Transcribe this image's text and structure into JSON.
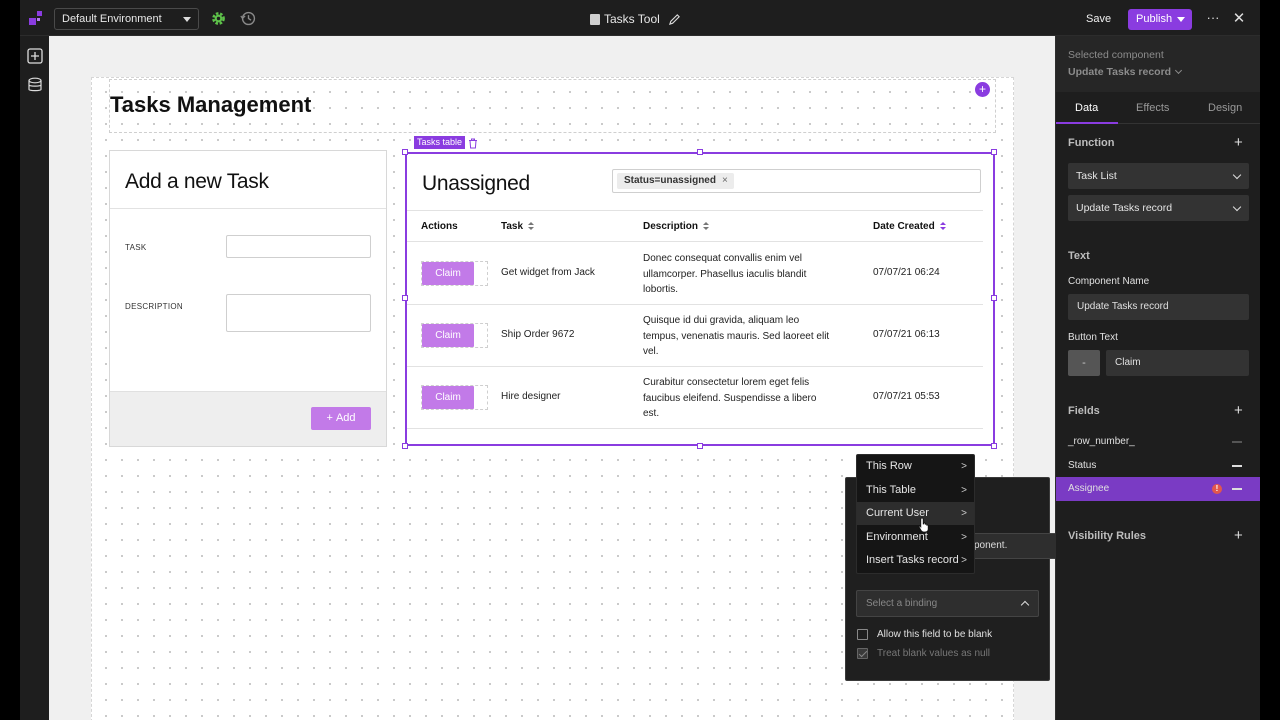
{
  "topbar": {
    "environment": "Default Environment",
    "doc_title": "Tasks Tool",
    "save_label": "Save",
    "publish_label": "Publish",
    "more_label": "···",
    "close_label": "✕"
  },
  "canvas": {
    "page_title": "Tasks Management",
    "add_card": {
      "title": "Add a new Task",
      "task_label": "TASK",
      "description_label": "DESCRIPTION",
      "task_value": "",
      "description_value": "",
      "add_button": "Add"
    },
    "table": {
      "label": "Tasks table",
      "title": "Unassigned",
      "filter_chip": "Status=unassigned",
      "columns": [
        "Actions",
        "Task",
        "Description",
        "Date Created"
      ],
      "rows": [
        {
          "action": "Claim",
          "task": "Get widget from Jack",
          "description": "Donec consequat convallis enim vel ullamcorper. Phasellus iaculis blandit lobortis.",
          "date": "07/07/21 06:24"
        },
        {
          "action": "Claim",
          "task": "Ship Order 9672",
          "description": "Quisque id dui gravida, aliquam leo tempus, venenatis mauris. Sed laoreet elit vel.",
          "date": "07/07/21 06:13"
        },
        {
          "action": "Claim",
          "task": "Hire designer",
          "description": "Curabitur consectetur lorem eget felis faucibus eleifend. Suspendisse a libero est.",
          "date": "07/07/21 05:53"
        }
      ]
    }
  },
  "context_menu": {
    "items": [
      {
        "label": "This Row",
        "arrow": ">"
      },
      {
        "label": "This Table",
        "arrow": ">"
      },
      {
        "label": "Current User",
        "arrow": ">"
      },
      {
        "label": "Environment",
        "arrow": ">"
      },
      {
        "label": "Insert Tasks record",
        "arrow": ">"
      }
    ],
    "hovered_index": 2
  },
  "binding_popover": {
    "partial_select_text": "ponent.",
    "binding_placeholder": "Select a binding",
    "allow_blank_label": "Allow this field to be blank",
    "allow_blank_checked": false,
    "blank_as_null_label": "Treat blank values as null",
    "blank_as_null_checked": true
  },
  "panel": {
    "selected_label": "Selected component",
    "selected_name": "Update Tasks record",
    "tabs": [
      "Data",
      "Effects",
      "Design"
    ],
    "active_tab": "Data",
    "function_title": "Function",
    "function_dd1": "Task List",
    "function_dd2": "Update Tasks record",
    "text_title": "Text",
    "component_name_label": "Component Name",
    "component_name_value": "Update Tasks record",
    "button_text_label": "Button Text",
    "button_text_minus": "-",
    "button_text_value": "Claim",
    "fields_title": "Fields",
    "fields": [
      {
        "name": "_row_number_"
      },
      {
        "name": "Status"
      },
      {
        "name": "Assignee",
        "warning": "!"
      }
    ],
    "visibility_title": "Visibility Rules"
  },
  "colors": {
    "accent": "#8a3ce0",
    "claim_button": "#c27ae8",
    "selected_row": "#7a3bc4",
    "warning": "#e2574c"
  }
}
